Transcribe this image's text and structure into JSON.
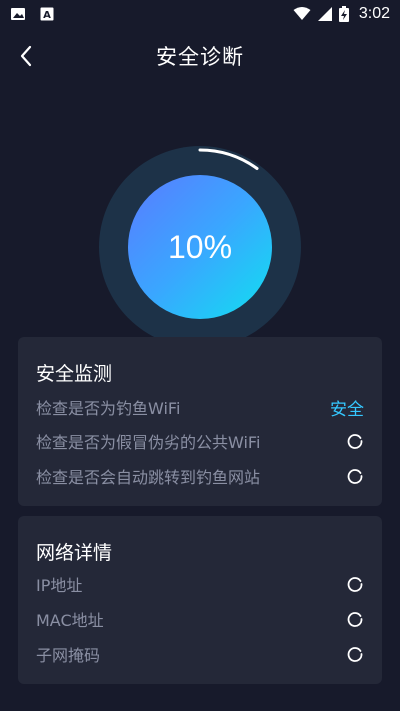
{
  "status_bar": {
    "time": "3:02",
    "left_icons": [
      "image-icon",
      "font-icon"
    ],
    "right_icons": [
      "wifi-icon",
      "signal-icon",
      "battery-charging-icon"
    ]
  },
  "header": {
    "title": "安全诊断"
  },
  "progress": {
    "text": "10%",
    "value": 0.1,
    "track_color": "#1d3248",
    "gradient_from": "#5a7bff",
    "gradient_to": "#10e0f0"
  },
  "security": {
    "title": "安全监测",
    "items": [
      {
        "label": "检查是否为钓鱼WiFi",
        "status": "安全"
      },
      {
        "label": "检查是否为假冒伪劣的公共WiFi",
        "status": ""
      },
      {
        "label": "检查是否会自动跳转到钓鱼网站",
        "status": ""
      }
    ]
  },
  "network": {
    "title": "网络详情",
    "items": [
      {
        "label": "IP地址"
      },
      {
        "label": "MAC地址"
      },
      {
        "label": "子网掩码"
      }
    ]
  },
  "colors": {
    "background": "#171a2b",
    "card": "#242838",
    "muted_text": "#8a8fa3",
    "accent": "#35c8ff"
  }
}
